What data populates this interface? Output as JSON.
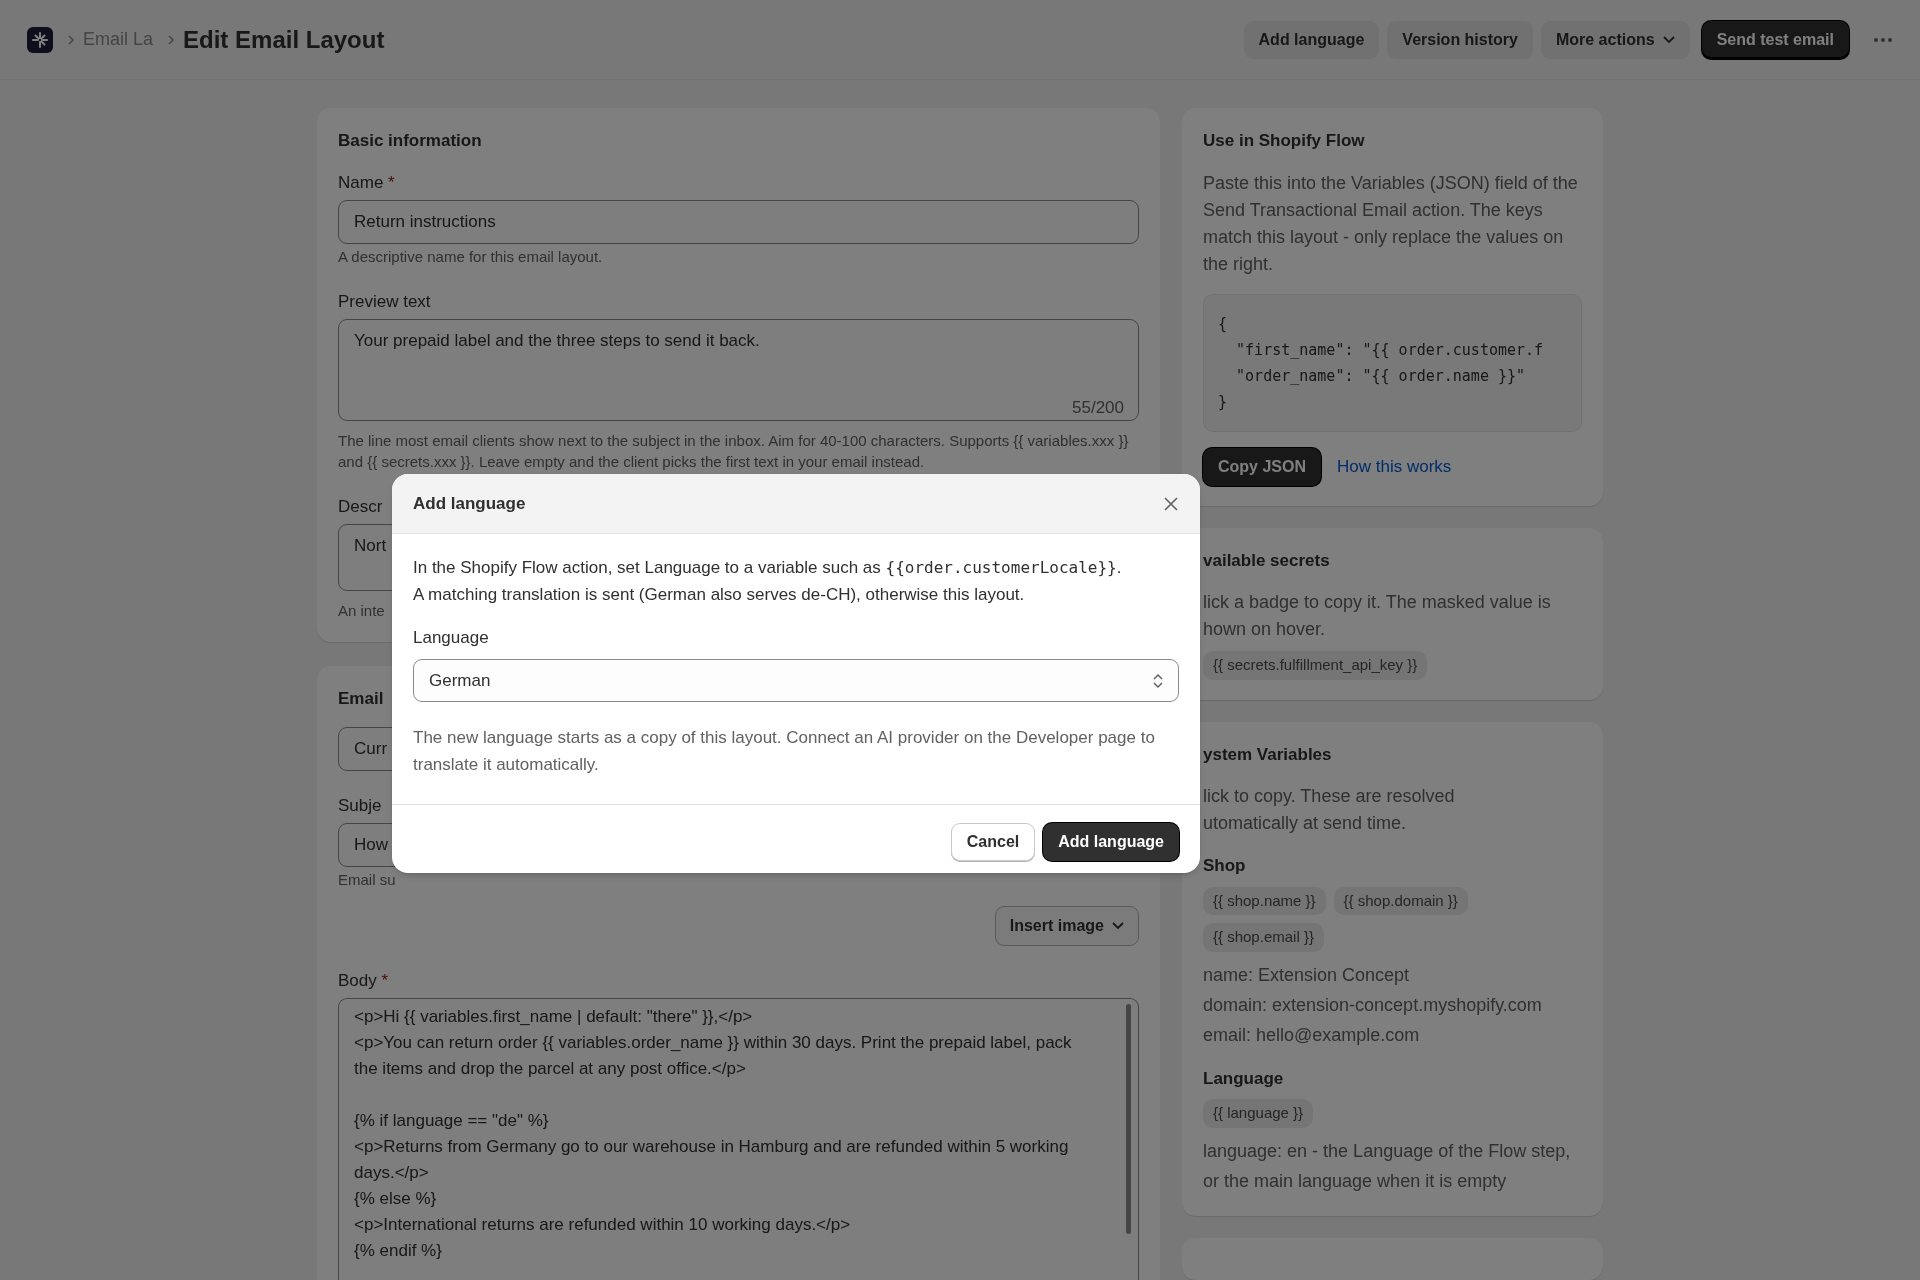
{
  "header": {
    "breadcrumb": [
      {
        "label": "Email La"
      }
    ],
    "title": "Edit Email Layout",
    "actions": [
      {
        "label": "Add language",
        "kind": "secondary"
      },
      {
        "label": "Version history",
        "kind": "secondary"
      },
      {
        "label": "More actions",
        "kind": "dropdown"
      },
      {
        "label": "Send test email",
        "kind": "primary"
      }
    ]
  },
  "main_cards": [
    {
      "title": "Basic information",
      "fields": [
        {
          "kind": "input",
          "label": "Name",
          "required_mark": "*",
          "value": "Return instructions",
          "help": "A descriptive name for this email layout."
        },
        {
          "kind": "textarea",
          "label": "Preview text",
          "value": "Your prepaid label and the three steps to send it back.",
          "counter": "55/200",
          "help": "The line most email clients show next to the subject in the inbox. Aim for 40-100 characters. Supports {{ variables.xxx }} and {{ secrets.xxx }}. Leave empty and the client picks the first text in your email instead."
        },
        {
          "kind": "textarea_short",
          "label": "Descr",
          "value": "Nort",
          "help": "An inte"
        }
      ]
    },
    {
      "title": "Email",
      "fields": [
        {
          "kind": "input",
          "value": "Curr"
        },
        {
          "kind": "input",
          "label": "Subje",
          "value": "How",
          "help": "Email su"
        },
        {
          "kind": "button",
          "label": "Insert image"
        },
        {
          "kind": "code",
          "label": "Body",
          "required_mark": "*",
          "value": "<p>Hi {{ variables.first_name | default: \"there\" }},</p>\n<p>You can return order {{ variables.order_name }} within 30 days. Print the prepaid label, pack the items and drop the parcel at any post office.</p>\n\n{% if language == \"de\" %}\n<p>Returns from Germany go to our warehouse in Hamburg and are refunded within 5 working days.</p>\n{% else %}\n<p>International returns are refunded within 10 working days.</p>\n{% endif %}"
        }
      ]
    }
  ],
  "side_cards": [
    {
      "kind": "flow",
      "title": "Use in Shopify Flow",
      "text": "Paste this into the Variables (JSON) field of the Send Transactional Email action. The keys match this layout - only replace the values on the right.",
      "code_lines": [
        "{",
        "  \"first_name\": \"{{ order.customer.f",
        "  \"order_name\": \"{{ order.name }}\"",
        "}"
      ],
      "button": "Copy JSON",
      "link": "How this works"
    },
    {
      "kind": "secrets",
      "title": "vailable secrets",
      "text_lines": [
        "lick a badge to copy it. The masked value is",
        "hown on hover."
      ],
      "badges": [
        "{{ secrets.fulfillment_api_key }}"
      ]
    },
    {
      "kind": "variables",
      "title": "ystem Variables",
      "text_lines": [
        "lick to copy. These are resolved",
        "utomatically at send time."
      ],
      "groups": [
        {
          "title": "Shop",
          "badges": [
            "{{ shop.name }}",
            "{{ shop.domain }}",
            "{{ shop.email }}"
          ],
          "lines": [
            "name: Extension Concept",
            "domain: extension-concept.myshopify.com",
            "email: hello@example.com"
          ]
        },
        {
          "title": "Language",
          "badges": [
            "{{ language }}"
          ],
          "lines": [
            "language: en - the Language of the Flow step, or the main language when it is empty"
          ]
        }
      ]
    },
    {
      "kind": "empty"
    }
  ],
  "modal": {
    "title": "Add language",
    "intro": [
      {
        "kind": "text",
        "text": "In the Shopify Flow action, set Language to a variable such as "
      },
      {
        "kind": "code",
        "text": "{{order.customerLocale}}"
      },
      {
        "kind": "text",
        "text": ". A matching translation is sent (German also serves de-CH), otherwise this layout."
      }
    ],
    "field_label": "Language",
    "select_value": "German",
    "note": "The new language starts as a copy of this layout. Connect an AI provider on the Developer page to translate it automatically.",
    "buttons": [
      {
        "label": "Cancel",
        "kind": "secondary"
      },
      {
        "label": "Add language",
        "kind": "primary"
      }
    ]
  }
}
